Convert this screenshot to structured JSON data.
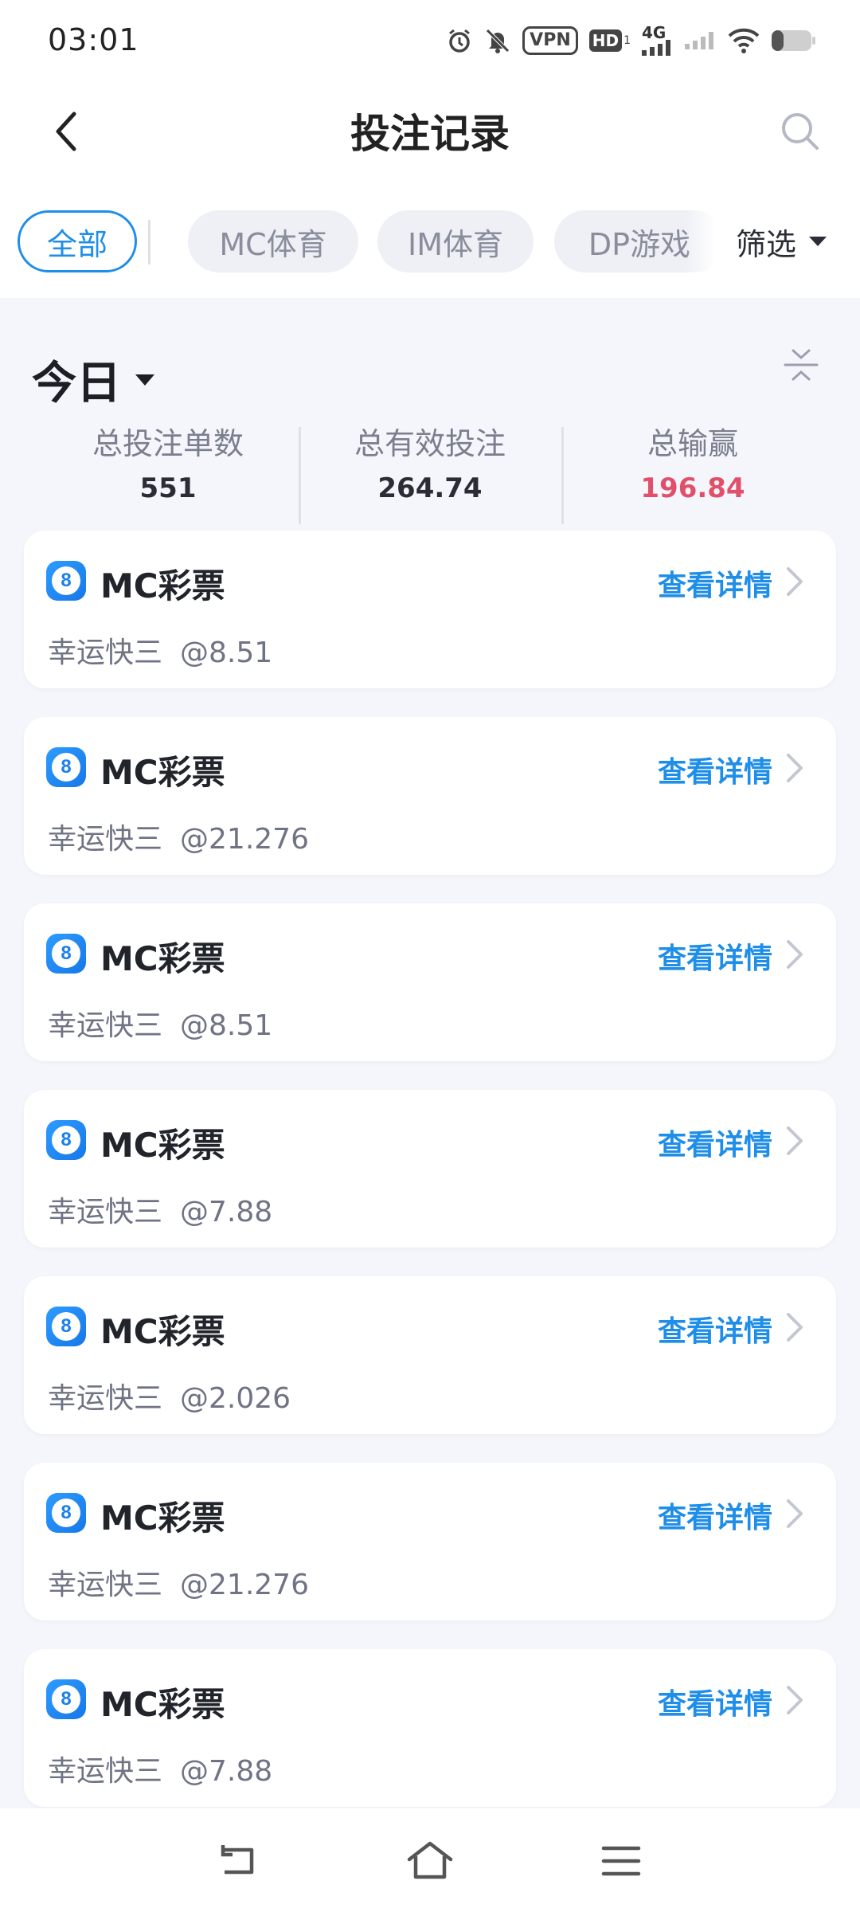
{
  "status_bar": {
    "time": "03:01",
    "icons": [
      "alarm-icon",
      "mute-icon",
      "vpn-icon",
      "hd-icon",
      "signal-4g-icon",
      "signal-icon",
      "wifi-icon",
      "battery-icon"
    ],
    "vpn_label": "VPN",
    "hd_label": "HD",
    "hd_sub": "1",
    "network_label": "4G",
    "battery_level": 0.3
  },
  "header": {
    "title": "投注记录"
  },
  "tabs": [
    {
      "label": "全部",
      "active": true
    },
    {
      "label": "MC体育",
      "active": false
    },
    {
      "label": "IM体育",
      "active": false
    },
    {
      "label": "DP游戏",
      "active": false
    }
  ],
  "filter": {
    "label": "筛选"
  },
  "summary": {
    "period": "今日",
    "stats": [
      {
        "label": "总投注单数",
        "value": "551"
      },
      {
        "label": "总有效投注",
        "value": "264.74"
      },
      {
        "label": "总输赢",
        "value": "196.84"
      }
    ]
  },
  "records": [
    {
      "title": "MC彩票",
      "detail_label": "查看详情",
      "game": "幸运快三",
      "odds": "@8.51"
    },
    {
      "title": "MC彩票",
      "detail_label": "查看详情",
      "game": "幸运快三",
      "odds": "@21.276"
    },
    {
      "title": "MC彩票",
      "detail_label": "查看详情",
      "game": "幸运快三",
      "odds": "@8.51"
    },
    {
      "title": "MC彩票",
      "detail_label": "查看详情",
      "game": "幸运快三",
      "odds": "@7.88"
    },
    {
      "title": "MC彩票",
      "detail_label": "查看详情",
      "game": "幸运快三",
      "odds": "@2.026"
    },
    {
      "title": "MC彩票",
      "detail_label": "查看详情",
      "game": "幸运快三",
      "odds": "@21.276"
    },
    {
      "title": "MC彩票",
      "detail_label": "查看详情",
      "game": "幸运快三",
      "odds": "@7.88"
    }
  ],
  "record_icon_glyph": "8",
  "colors": {
    "accent": "#1f8ee8",
    "loss": "#e0506a",
    "background": "#f5f6fb"
  },
  "nav": {
    "icons": [
      "back-nav-icon",
      "home-icon",
      "menu-icon"
    ]
  }
}
